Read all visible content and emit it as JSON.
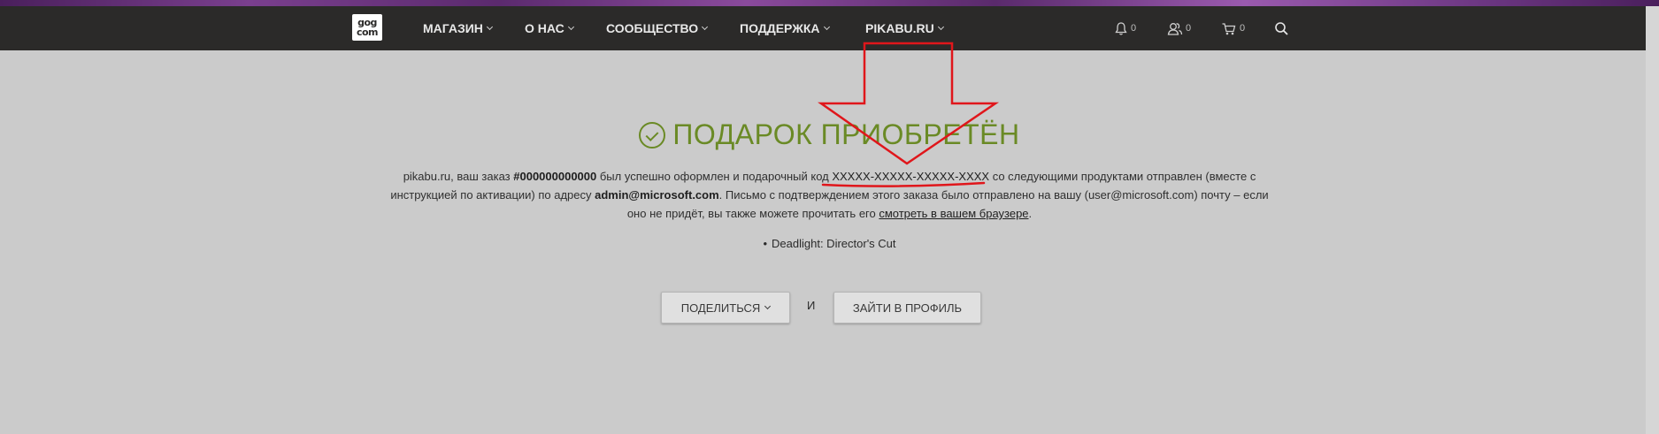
{
  "header": {
    "logo_line1": "gog",
    "logo_line2": "com",
    "nav": [
      {
        "label": "МАГАЗИН"
      },
      {
        "label": "О НАС"
      },
      {
        "label": "СООБЩЕСТВО"
      },
      {
        "label": "ПОДДЕРЖКА"
      },
      {
        "label": "PIKABU.RU"
      }
    ],
    "notifications_count": "0",
    "friends_count": "0",
    "cart_count": "0"
  },
  "main": {
    "title": "ПОДАРОК ПРИОБРЕТЁН",
    "message": {
      "part1": "pikabu.ru, ваш заказ ",
      "order_number": "#000000000000",
      "part2": " был успешно оформлен и подарочный код ",
      "gift_code": "XXXXX-XXXXX-XXXXX-XXXX",
      "part3": " со следующими продуктами отправлен (вместе с инструкцией по активации) по адресу ",
      "email": "admin@microsoft.com",
      "part4": ". Письмо с подтверждением этого заказа было отправлено на вашу (user@microsoft.com) почту – если оно не придёт, вы также можете прочитать его ",
      "browser_link": "смотреть в вашем браузере",
      "part5": "."
    },
    "products": [
      "Deadlight: Director's Cut"
    ],
    "share_button": "ПОДЕЛИТЬСЯ",
    "and_text": "И",
    "profile_button": "ЗАЙТИ В ПРОФИЛЬ"
  },
  "colors": {
    "header_bg": "#2b2a29",
    "page_bg": "#cbcbcb",
    "success_green": "#6a8a25",
    "annotation_red": "#e0161b"
  }
}
